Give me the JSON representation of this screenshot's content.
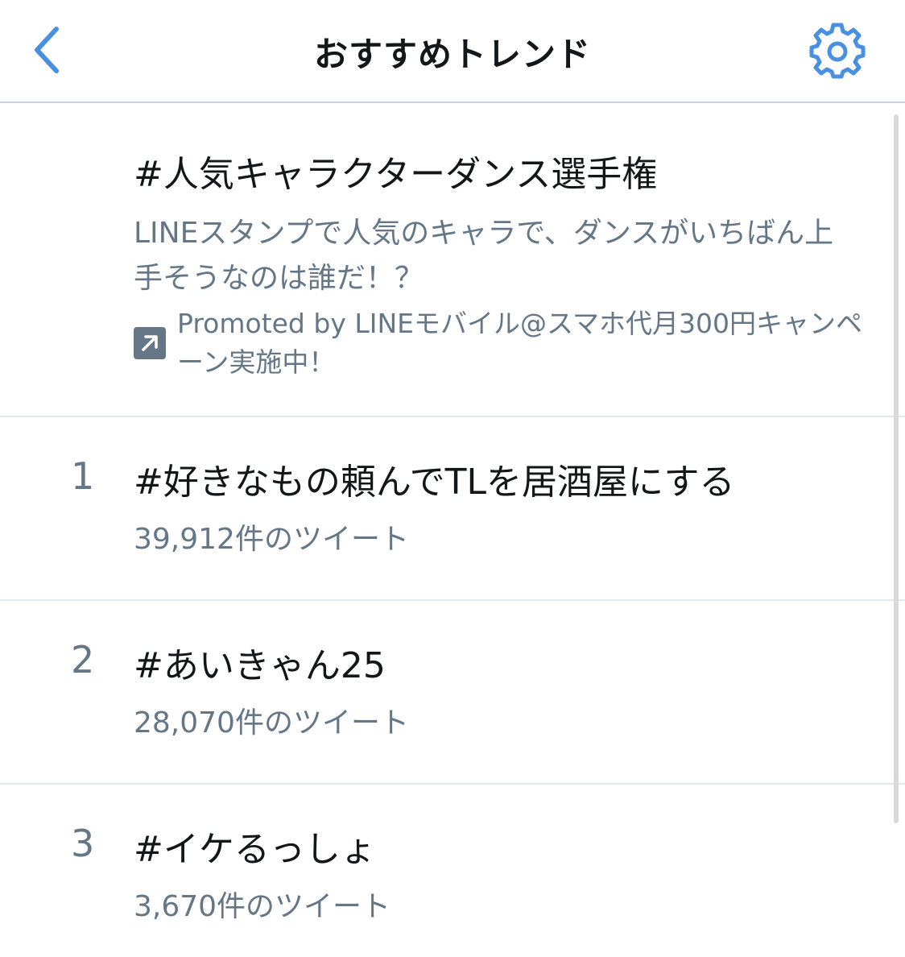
{
  "header": {
    "title": "おすすめトレンド",
    "back_icon": "chevron-left-icon",
    "settings_icon": "gear-icon",
    "accent_color": "#4a90e2"
  },
  "promoted": {
    "title": "#人気キャラクターダンス選手権",
    "description": "LINEスタンプで人気のキャラで、ダンスがいちばん上手そうなのは誰だ！？",
    "promoted_by": "Promoted by LINEモバイル@スマホ代月300円キャンペーン実施中！",
    "icon": "promoted-arrow-icon"
  },
  "trends": [
    {
      "rank": "1",
      "name": "#好きなもの頼んでTLを居酒屋にする",
      "count": "39,912件のツイート"
    },
    {
      "rank": "2",
      "name": "#あいきゃん25",
      "count": "28,070件のツイート"
    },
    {
      "rank": "3",
      "name": "#イケるっしょ",
      "count": "3,670件のツイート"
    }
  ]
}
